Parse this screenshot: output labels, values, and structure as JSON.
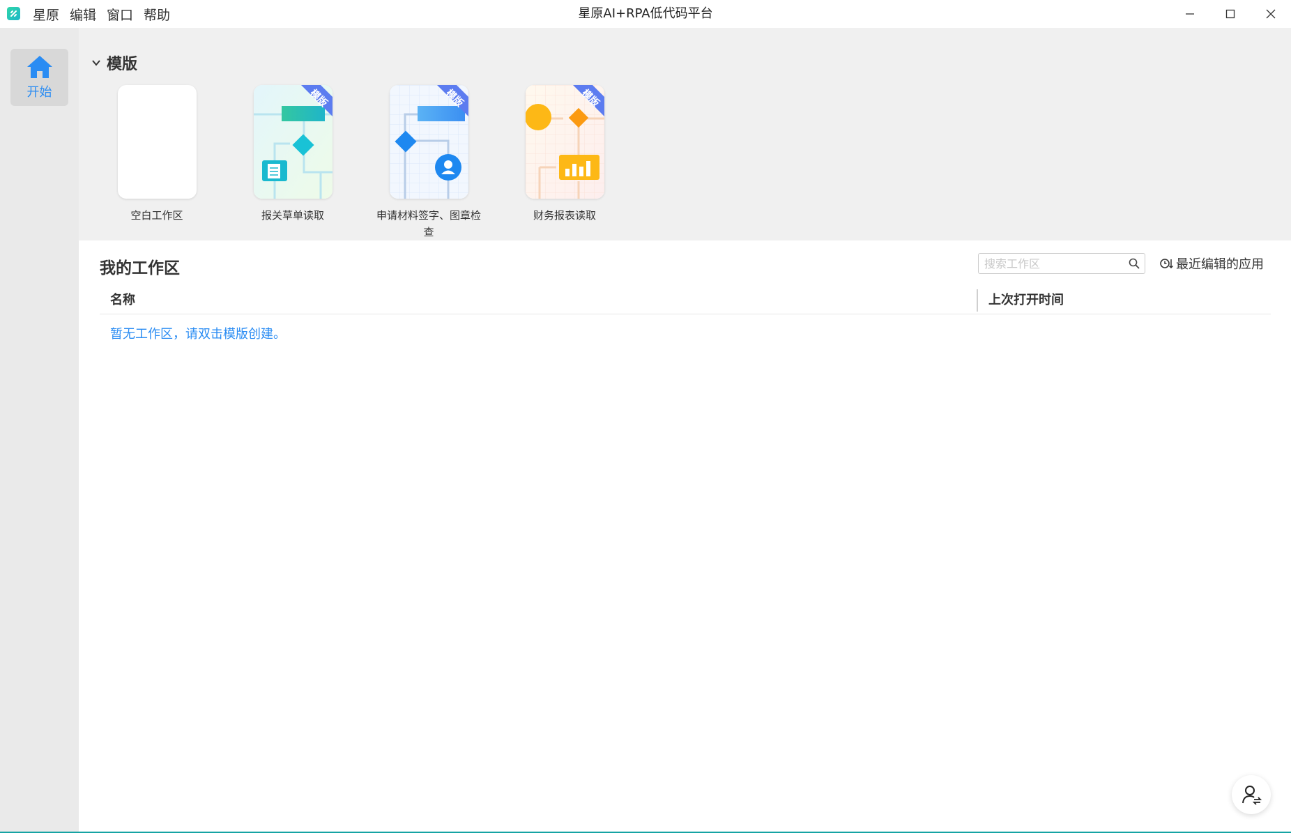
{
  "window": {
    "title": "星原AI+RPA低代码平台",
    "menu": [
      "星原",
      "编辑",
      "窗口",
      "帮助"
    ]
  },
  "sidebar": {
    "items": [
      {
        "label": "开始",
        "icon": "home-icon",
        "active": true
      }
    ]
  },
  "templates": {
    "section_title": "模版",
    "badge": "模版",
    "cards": [
      {
        "label": "空白工作区",
        "icon": "blank-template"
      },
      {
        "label": "报关草单读取",
        "icon": "document-flow-template"
      },
      {
        "label": "申请材料签字、图章检查",
        "icon": "person-flow-template"
      },
      {
        "label": "财务报表读取",
        "icon": "chart-flow-template"
      }
    ]
  },
  "workspace": {
    "title": "我的工作区",
    "search_placeholder": "搜索工作区",
    "sort_label": "最近编辑的应用",
    "columns": {
      "name": "名称",
      "last_opened": "上次打开时间"
    },
    "empty_message": "暂无工作区，请双击模版创建。"
  },
  "colors": {
    "accent": "#2a8cf3",
    "sidebar_bg": "#eaeaea",
    "templates_bg": "#f0f0f0"
  }
}
